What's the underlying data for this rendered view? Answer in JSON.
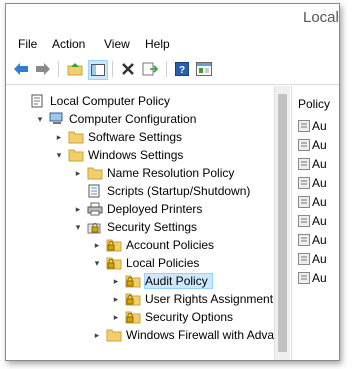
{
  "window": {
    "title": "Local"
  },
  "menubar": {
    "items": [
      "File",
      "Action",
      "View",
      "Help"
    ]
  },
  "toolbar": {
    "icons": [
      "back-arrow-icon",
      "forward-arrow-icon",
      "up-folder-icon",
      "show-hide-tree-icon",
      "delete-icon",
      "export-list-icon",
      "help-icon",
      "properties-icon"
    ]
  },
  "tree": {
    "nodes": [
      {
        "label": "Local Computer Policy",
        "level": 0,
        "expander": "",
        "icon": "policy-icon"
      },
      {
        "label": "Computer Configuration",
        "level": 1,
        "expander": "▾",
        "icon": "computer-icon"
      },
      {
        "label": "Software Settings",
        "level": 2,
        "expander": "▸",
        "icon": "folder-icon"
      },
      {
        "label": "Windows Settings",
        "level": 2,
        "expander": "▾",
        "icon": "folder-icon"
      },
      {
        "label": "Name Resolution Policy",
        "level": 3,
        "expander": "▸",
        "icon": "folder-icon"
      },
      {
        "label": "Scripts (Startup/Shutdown)",
        "level": 3,
        "expander": "",
        "icon": "script-icon"
      },
      {
        "label": "Deployed Printers",
        "level": 3,
        "expander": "▸",
        "icon": "printer-icon"
      },
      {
        "label": "Security Settings",
        "level": 3,
        "expander": "▾",
        "icon": "security-icon"
      },
      {
        "label": "Account Policies",
        "level": 4,
        "expander": "▸",
        "icon": "lock-folder-icon"
      },
      {
        "label": "Local Policies",
        "level": 4,
        "expander": "▾",
        "icon": "lock-folder-icon"
      },
      {
        "label": "Audit Policy",
        "level": 5,
        "expander": "▸",
        "icon": "lock-folder-icon",
        "selected": true
      },
      {
        "label": "User Rights Assignment",
        "level": 5,
        "expander": "▸",
        "icon": "lock-folder-icon"
      },
      {
        "label": "Security Options",
        "level": 5,
        "expander": "▸",
        "icon": "lock-folder-icon"
      },
      {
        "label": "Windows Firewall with Advar",
        "level": 4,
        "expander": "▸",
        "icon": "folder-icon"
      }
    ]
  },
  "right_pane": {
    "header": "Policy",
    "rows": [
      "Au",
      "Au",
      "Au",
      "Au",
      "Au",
      "Au",
      "Au",
      "Au",
      "Au"
    ]
  }
}
